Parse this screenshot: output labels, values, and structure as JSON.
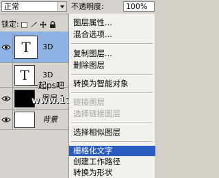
{
  "panel": {
    "blend_mode": "正常",
    "opacity_label": "不透明度:",
    "opacity_value": "100%",
    "lock_label": "锁定:"
  },
  "layers": [
    {
      "name": "3D",
      "thumb": "T",
      "selected": true,
      "italic": false
    },
    {
      "name": "3D",
      "thumb": "T",
      "selected": false,
      "italic": false
    },
    {
      "name": "图层 1",
      "thumb": "",
      "selected": false,
      "italic": false
    },
    {
      "name": "背景",
      "thumb": "",
      "selected": false,
      "italic": true
    }
  ],
  "watermark": "一起ps吧",
  "watermark_site": "www.17ps8.com",
  "menu": {
    "items": [
      {
        "label": "图层属性...",
        "enabled": true
      },
      {
        "label": "混合选项...",
        "enabled": true
      },
      {
        "label": "复制图层...",
        "enabled": true
      },
      {
        "label": "删除图层",
        "enabled": true
      },
      {
        "label": "转换为智能对象",
        "enabled": true
      },
      {
        "label": "链接图层",
        "enabled": false
      },
      {
        "label": "选择链接图层",
        "enabled": false
      },
      {
        "label": "选择相似图层",
        "enabled": true
      },
      {
        "label": "栅格化文字",
        "enabled": true,
        "highlight": true
      },
      {
        "label": "创建工作路径",
        "enabled": true
      },
      {
        "label": "转换为形状",
        "enabled": true
      }
    ]
  },
  "colors": {
    "selection": "#8fb2e5",
    "menu_highlight": "#2c5bbf",
    "panel_bg": "#d6d3ce",
    "menu_bg": "#f2f1ee"
  }
}
